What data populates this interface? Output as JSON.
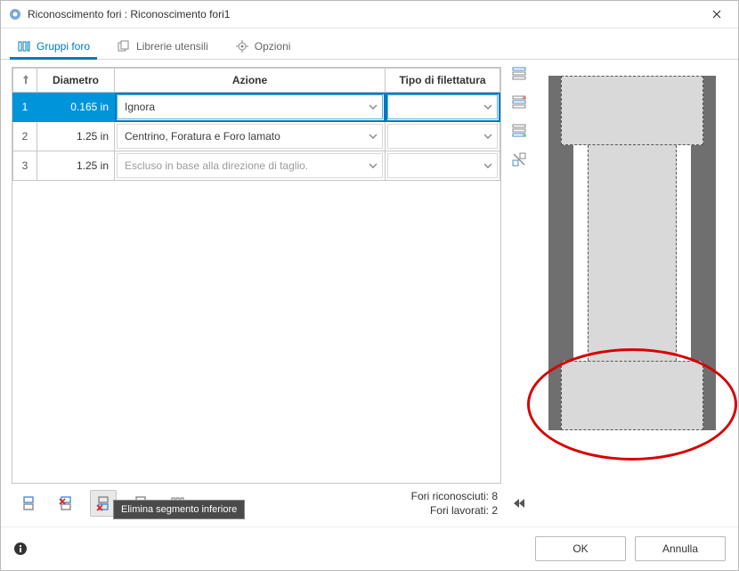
{
  "window": {
    "title": "Riconoscimento fori : Riconoscimento fori1"
  },
  "tabs": {
    "groups": "Gruppi foro",
    "libraries": "Librerie utensili",
    "options": "Opzioni"
  },
  "table": {
    "headers": {
      "diameter": "Diametro",
      "action": "Azione",
      "thread_type": "Tipo di filettatura"
    },
    "rows": [
      {
        "n": "1",
        "diameter": "0.165 in",
        "action": "Ignora",
        "thread": "",
        "selected": true,
        "disabled": false
      },
      {
        "n": "2",
        "diameter": "1.25 in",
        "action": "Centrino, Foratura e Foro lamato",
        "thread": "",
        "selected": false,
        "disabled": false
      },
      {
        "n": "3",
        "diameter": "1.25 in",
        "action": "Escluso in base alla direzione di taglio.",
        "thread": "",
        "selected": false,
        "disabled": true
      }
    ]
  },
  "stats": {
    "recognized_label": "Fori riconosciuti:",
    "recognized_value": "8",
    "machined_label": "Fori lavorati:",
    "machined_value": "2"
  },
  "tooltip": "Elimina segmento inferiore",
  "footer": {
    "ok": "OK",
    "cancel": "Annulla"
  }
}
